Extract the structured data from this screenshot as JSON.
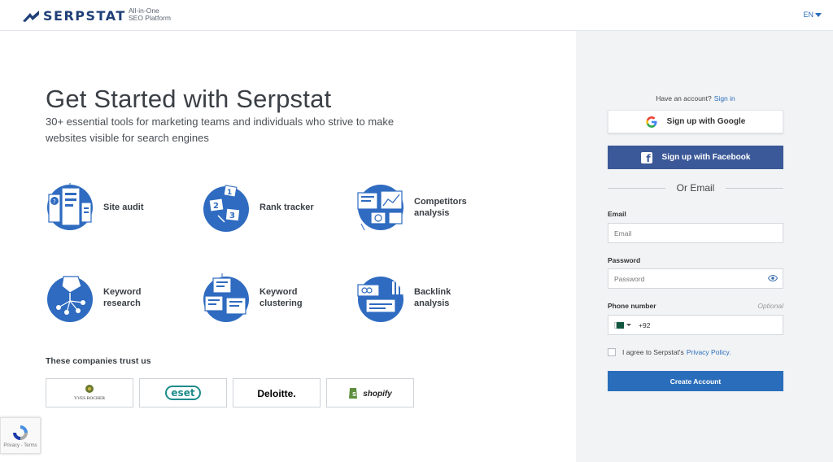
{
  "header": {
    "logo_text": "SERPSTAT",
    "tagline_line1": "All-in-One",
    "tagline_line2": "SEO Platform",
    "language": "EN"
  },
  "hero": {
    "title": "Get Started with Serpstat",
    "subtitle": "30+ essential tools for marketing teams and individuals who strive to make websites visible for search engines"
  },
  "features": [
    {
      "label": "Site audit",
      "icon": "site-audit-icon"
    },
    {
      "label": "Rank tracker",
      "icon": "rank-tracker-icon"
    },
    {
      "label": "Competitors analysis",
      "icon": "competitors-analysis-icon"
    },
    {
      "label": "Keyword research",
      "icon": "keyword-research-icon"
    },
    {
      "label": "Keyword clustering",
      "icon": "keyword-clustering-icon"
    },
    {
      "label": "Backlink analysis",
      "icon": "backlink-analysis-icon"
    }
  ],
  "trust": {
    "title": "These companies trust us",
    "companies": [
      "YVES ROCHER",
      "eset",
      "Deloitte.",
      "shopify"
    ]
  },
  "recaptcha": {
    "text": "Privacy - Terms"
  },
  "signup": {
    "have_account": "Have an account?",
    "sign_in": "Sign in",
    "google_label": "Sign up with Google",
    "facebook_label": "Sign up with Facebook",
    "or_email": "Or Email",
    "email_label": "Email",
    "email_placeholder": "Email",
    "password_label": "Password",
    "password_placeholder": "Password",
    "phone_label": "Phone number",
    "phone_optional": "Optional",
    "phone_code": "+92",
    "agree_text": "I agree to Serpstat's",
    "privacy_link": "Privacy Policy.",
    "create_label": "Create Account"
  },
  "colors": {
    "brand_blue": "#2a6ebb",
    "logo_navy": "#1f3f78",
    "facebook": "#3b5998",
    "panel_bg": "#f2f3f5",
    "icon_blue": "#2f6bc0"
  }
}
